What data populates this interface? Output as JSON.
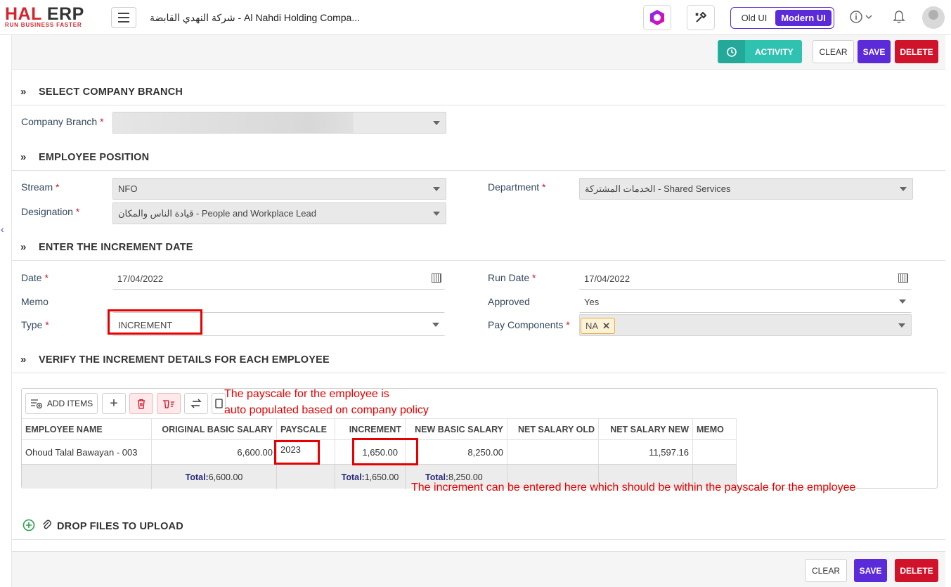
{
  "app": {
    "logo_main_a": "HAL",
    "logo_main_b": " ERP",
    "logo_tagline": "RUN BUSINESS FASTER",
    "company_title": "شركة النهدي القابضة - Al Nahdi Holding Compa...",
    "ui_old": "Old UI",
    "ui_modern": "Modern UI"
  },
  "toolbar": {
    "activity": "ACTIVITY",
    "clear": "CLEAR",
    "save": "SAVE",
    "delete": "DELETE"
  },
  "sections": {
    "branch": "SELECT COMPANY BRANCH",
    "position": "EMPLOYEE POSITION",
    "date": "ENTER THE INCREMENT DATE",
    "verify": "VERIFY THE INCREMENT DETAILS FOR EACH EMPLOYEE",
    "files": "DROP FILES TO UPLOAD"
  },
  "form": {
    "company_branch_label": "Company Branch",
    "stream_label": "Stream",
    "stream_value": "NFO",
    "department_label": "Department",
    "department_value": "الخدمات المشتركة - Shared Services",
    "designation_label": "Designation",
    "designation_value": "قيادة الناس والمكان - People and Workplace Lead",
    "date_label": "Date",
    "date_value": "17/04/2022",
    "run_date_label": "Run Date",
    "run_date_value": "17/04/2022",
    "memo_label": "Memo",
    "memo_value": "",
    "approved_label": "Approved",
    "approved_value": "Yes",
    "type_label": "Type",
    "type_value": "INCREMENT",
    "pay_components_label": "Pay Components",
    "pay_components_chip": "NA",
    "required_mark": "*"
  },
  "grid": {
    "add_items": "ADD ITEMS",
    "columns": [
      "EMPLOYEE NAME",
      "ORIGINAL BASIC SALARY",
      "PAYSCALE",
      "INCREMENT",
      "NEW BASIC SALARY",
      "NET SALARY OLD",
      "NET SALARY NEW",
      "MEMO"
    ],
    "row": {
      "employee_name": "Ohoud Talal Bawayan - 003",
      "original_basic_salary": "6,600.00",
      "payscale": "2023",
      "increment": "1,650.00",
      "new_basic_salary": "8,250.00",
      "net_salary_old": "",
      "net_salary_new": "11,597.16",
      "memo": ""
    },
    "totals": {
      "label": "Total:",
      "original_basic_salary": "6,600.00",
      "increment": "1,650.00",
      "new_basic_salary": "8,250.00"
    }
  },
  "annotations": {
    "payscale_note_line1": "The payscale for the employee is",
    "payscale_note_line2": "auto populated based on company policy",
    "increment_note": "The increment can be entered here which should be within the payscale for the employee"
  },
  "colors": {
    "brand_red": "#d7232b",
    "primary_purple": "#5b2bd9",
    "delete_red": "#d0122b",
    "activity_teal": "#2fc2b1",
    "annotation_red": "#e60000"
  }
}
